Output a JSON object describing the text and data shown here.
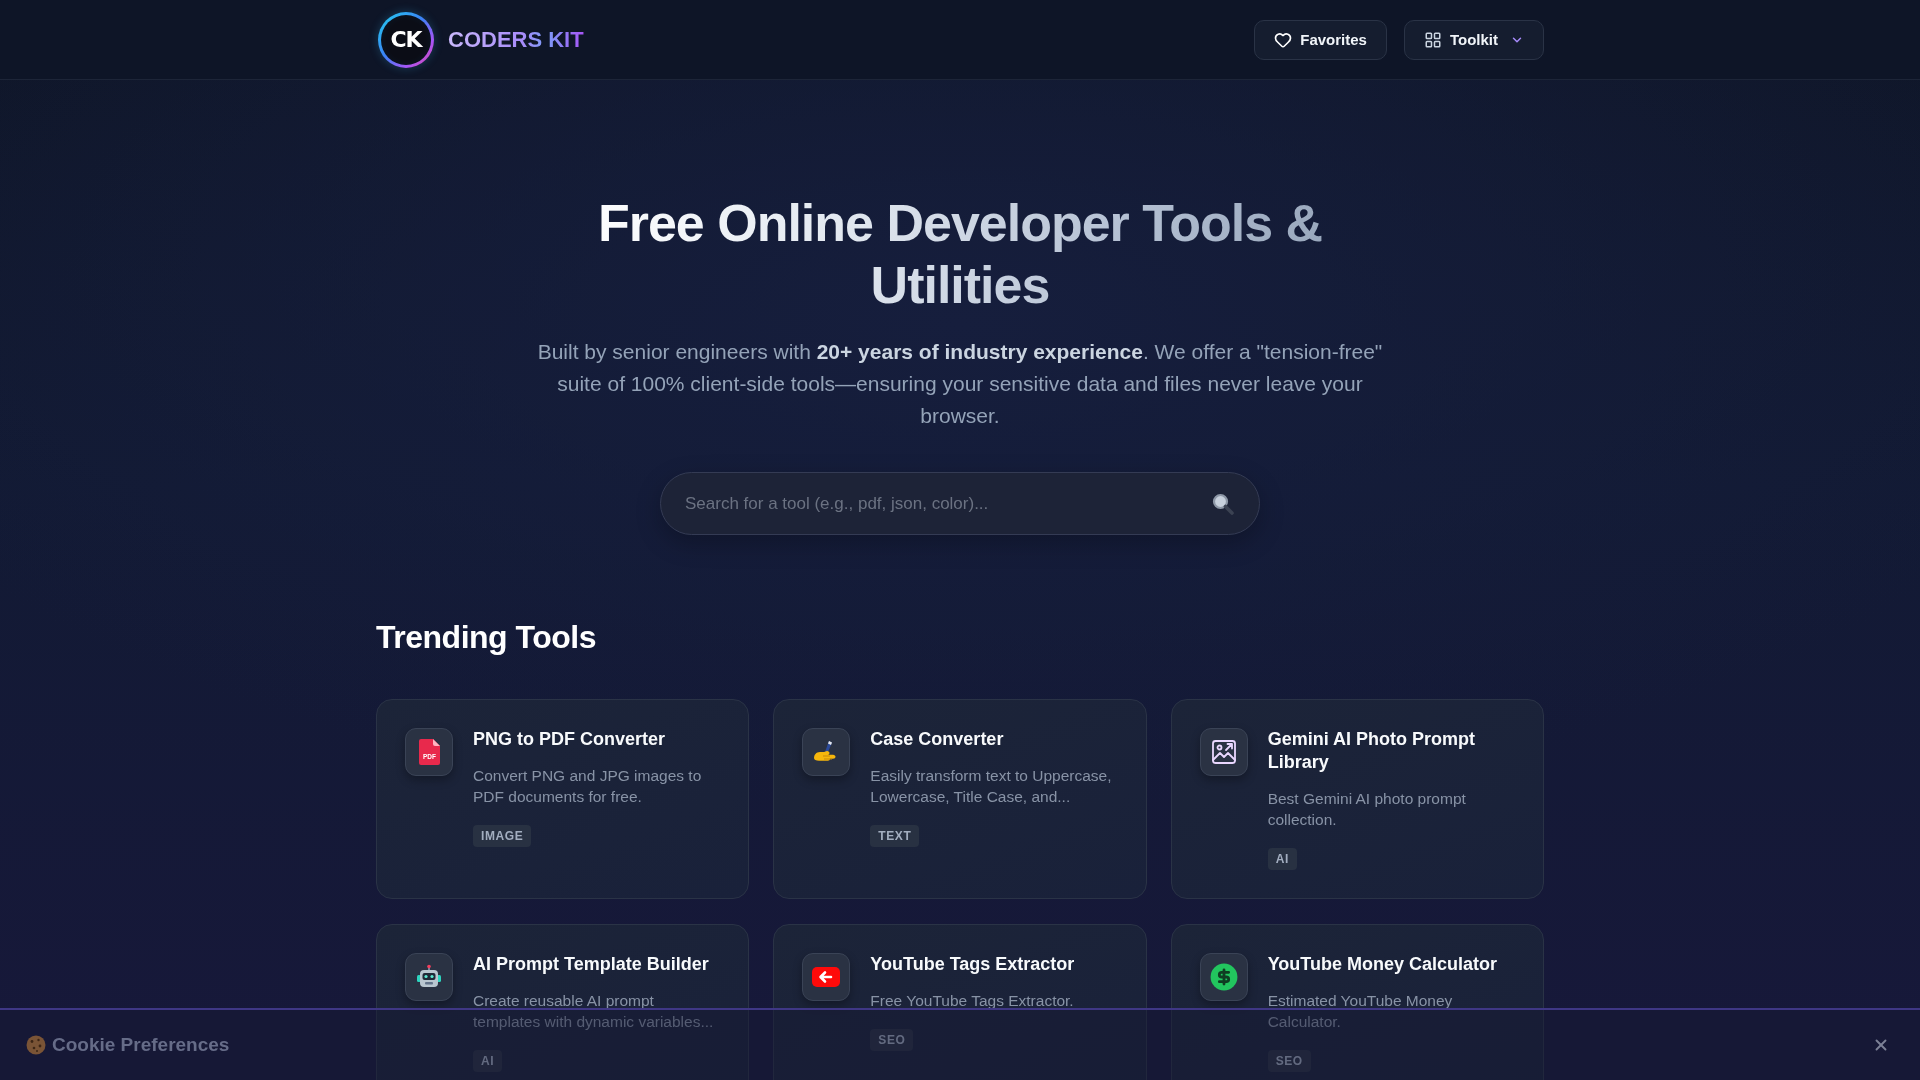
{
  "header": {
    "logo": {
      "mark": "CK"
    },
    "brand": "CODERS KIT",
    "actions": [
      {
        "label": "Favorites",
        "kind": "button"
      },
      {
        "label": "Toolkit",
        "kind": "dropdown"
      }
    ]
  },
  "hero": {
    "title": "Free Online Developer Tools & Utilities",
    "description": "Built by senior engineers with **20+ years of industry experience**. We offer a \"tension-free\" suite of 100% client-side tools—ensuring your sensitive data and files never leave your browser.",
    "search": {
      "placeholder": "Search for a tool (e.g., pdf, json, color)..."
    }
  },
  "trending": {
    "heading": "Trending Tools",
    "tools": [
      {
        "title": "PNG to PDF Converter",
        "description": "Convert PNG and JPG images to PDF documents for free.",
        "tag": "IMAGE",
        "icon_text": "PDF"
      },
      {
        "title": "Case Converter",
        "description": "Easily transform text to Uppercase, Lowercase, Title Case, and...",
        "tag": "TEXT"
      },
      {
        "title": "Gemini AI Photo Prompt Library",
        "description": "Best Gemini AI photo prompt collection.",
        "tag": "AI"
      },
      {
        "title": "AI Prompt Template Builder",
        "description": "Create reusable AI prompt templates with dynamic variables...",
        "tag": "AI"
      },
      {
        "title": "YouTube Tags Extractor",
        "description": "Free YouTube Tags Extractor.",
        "tag": "SEO"
      },
      {
        "title": "YouTube Money Calculator",
        "description": "Estimated YouTube Money Calculator.",
        "tag": "SEO"
      }
    ]
  },
  "cookie_bar": {
    "label": "Cookie Preferences"
  }
}
